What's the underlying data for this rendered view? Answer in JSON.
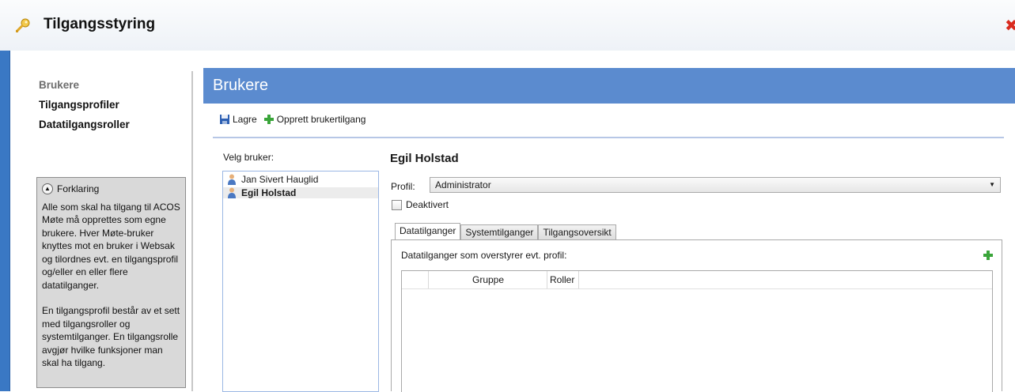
{
  "window": {
    "title": "Tilgangsstyring"
  },
  "nav": {
    "items": [
      {
        "label": "Brukere",
        "active": true
      },
      {
        "label": "Tilgangsprofiler",
        "active": false
      },
      {
        "label": "Datatilgangsroller",
        "active": false
      }
    ]
  },
  "explanation": {
    "title": "Forklaring",
    "paragraph1": "Alle som skal ha tilgang til ACOS Møte må opprettes som egne brukere. Hver Møte-bruker knyttes mot en bruker i Websak og tilordnes evt. en tilgangsprofil og/eller en eller flere datatilganger.",
    "paragraph2": "En tilgangsprofil består av et sett med tilgangsroller og systemtilganger. En tilgangsrolle avgjør hvilke funksjoner man skal ha tilgang."
  },
  "panel": {
    "title": "Brukere"
  },
  "toolbar": {
    "save_label": "Lagre",
    "create_label": "Opprett brukertilgang"
  },
  "users": {
    "label": "Velg bruker:",
    "items": [
      {
        "name": "Jan Sivert Hauglid",
        "selected": false
      },
      {
        "name": "Egil Holstad",
        "selected": true
      }
    ]
  },
  "detail": {
    "name": "Egil Holstad",
    "profile_label": "Profil:",
    "profile_value": "Administrator",
    "deactivated_label": "Deaktivert",
    "deactivated": false
  },
  "tabs": [
    {
      "label": "Datatilganger",
      "active": true
    },
    {
      "label": "Systemtilganger",
      "active": false
    },
    {
      "label": "Tilgangsoversikt",
      "active": false
    }
  ],
  "datatilganger": {
    "description": "Datatilganger som overstyrer evt. profil:",
    "columns": [
      "Gruppe",
      "Roller"
    ]
  },
  "colors": {
    "frame": "#3a78c4",
    "panel_header": "#5b8bcf",
    "close": "#d92b1f",
    "add": "#3aa53a"
  }
}
